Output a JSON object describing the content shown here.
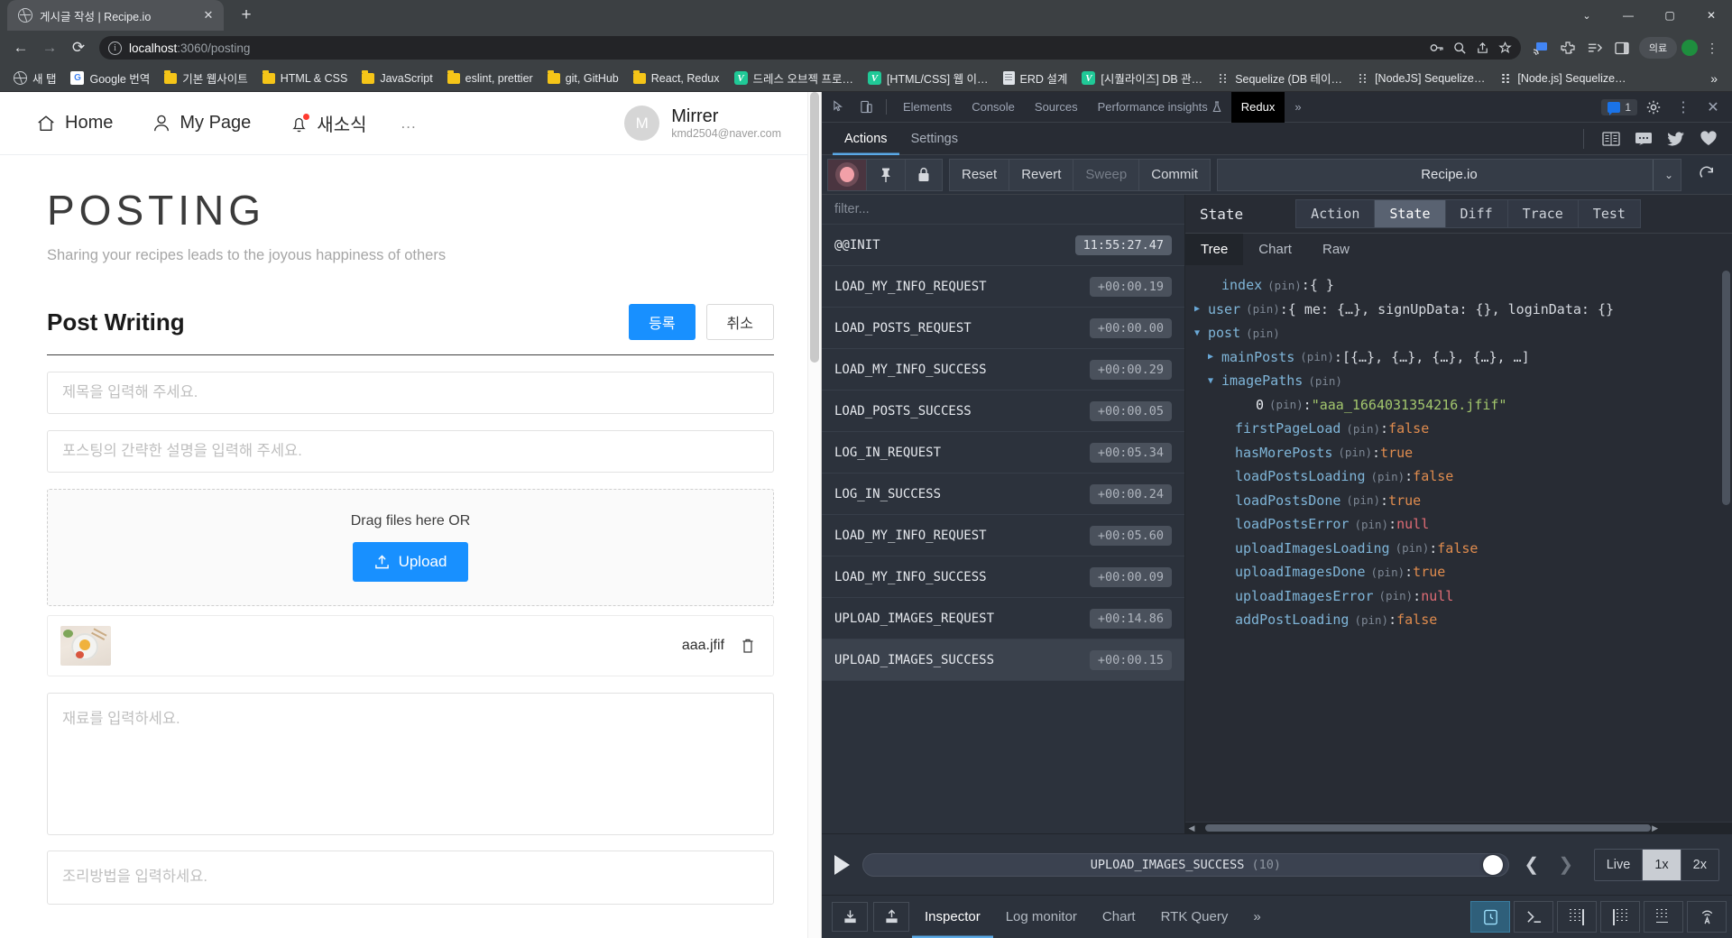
{
  "browser": {
    "tab": {
      "title": "게시글 작성 | Recipe.io",
      "close": "✕"
    },
    "newtab": "+",
    "window_controls": {
      "minimize": "—",
      "maximize": "▢",
      "close": "✕",
      "chevron": "⌄"
    },
    "nav": {
      "back": "←",
      "forward": "→",
      "reload": "⟳"
    },
    "url": {
      "host": "localhost",
      "path": ":3060/posting"
    },
    "omni_icons": [
      "key-icon",
      "zoom-icon",
      "share-icon",
      "bookmark-star-icon"
    ],
    "toolbar_icons": [
      "extension-cast-icon",
      "puzzle-extension-icon",
      "reading-list-icon",
      "sidepanel-icon"
    ],
    "profile_pill": "의료",
    "bookmarks": [
      {
        "label": "새 탭",
        "icon": "globe-icon"
      },
      {
        "label": "Google 번역",
        "icon": "google-translate-icon"
      },
      {
        "label": "기본 웹사이트",
        "icon": "folder-icon"
      },
      {
        "label": "HTML & CSS",
        "icon": "folder-icon"
      },
      {
        "label": "JavaScript",
        "icon": "folder-icon"
      },
      {
        "label": "eslint, prettier",
        "icon": "folder-icon"
      },
      {
        "label": "git, GitHub",
        "icon": "folder-icon"
      },
      {
        "label": "React, Redux",
        "icon": "folder-icon"
      },
      {
        "label": "드레스 오브젝 프로…",
        "icon": "velog-icon"
      },
      {
        "label": "[HTML/CSS] 웹 이…",
        "icon": "velog-icon"
      },
      {
        "label": "ERD 설계",
        "icon": "document-icon"
      },
      {
        "label": "[시퀄라이즈] DB 관…",
        "icon": "velog-icon"
      },
      {
        "label": "Sequelize (DB 테이…",
        "icon": "dots-icon"
      },
      {
        "label": "[NodeJS] Sequelize…",
        "icon": "dots-icon"
      },
      {
        "label": "[Node.js] Sequelize…",
        "icon": "dots-icon"
      }
    ],
    "bookmarks_overflow": "»"
  },
  "page": {
    "nav": [
      {
        "label": "Home",
        "icon": "home-icon"
      },
      {
        "label": "My Page",
        "icon": "user-icon"
      },
      {
        "label": "새소식",
        "icon": "bell-icon",
        "badge": true
      },
      {
        "label": "...",
        "icon": "more-icon"
      }
    ],
    "profile": {
      "initial": "M",
      "name": "Mirrer",
      "email": "kmd2504@naver.com"
    },
    "hero_title": "POSTING",
    "hero_subtitle": "Sharing your recipes leads to the joyous happiness of others",
    "section_title": "Post Writing",
    "submit_label": "등록",
    "cancel_label": "취소",
    "title_placeholder": "제목을 입력해 주세요.",
    "desc_placeholder": "포스팅의 간략한 설명을 입력해 주세요.",
    "dropzone_text": "Drag files here OR",
    "upload_label": "Upload",
    "file": {
      "name": "aaa.jfif",
      "delete_icon": "trash-icon",
      "thumb": "food-thumbnail"
    },
    "ingredients_placeholder": "재료를 입력하세요.",
    "recipe_placeholder": "조리방법을 입력하세요."
  },
  "devtools": {
    "top_tabs": [
      {
        "label": "Elements",
        "active": false
      },
      {
        "label": "Console",
        "active": false
      },
      {
        "label": "Sources",
        "active": false
      },
      {
        "label": "Performance insights",
        "active": false,
        "icon": "flask-icon"
      },
      {
        "label": "Redux",
        "active": true
      }
    ],
    "top_overflow": "»",
    "message_count": "1",
    "top_right_icons": [
      "settings-gear-icon",
      "more-vertical-icon",
      "close-icon"
    ],
    "inspect_icons": [
      "inspect-element-icon",
      "device-toolbar-icon"
    ],
    "redux_tabs": [
      {
        "label": "Actions",
        "active": true
      },
      {
        "label": "Settings",
        "active": false
      }
    ],
    "social_icons": [
      "docs-book-icon",
      "chat-icon",
      "twitter-icon",
      "heart-icon"
    ],
    "dispatch": {
      "record_icon": "record-icon",
      "pin_icon": "pin-icon",
      "lock_icon": "lock-icon",
      "buttons": [
        {
          "label": "Reset",
          "disabled": false
        },
        {
          "label": "Revert",
          "disabled": false
        },
        {
          "label": "Sweep",
          "disabled": true
        },
        {
          "label": "Commit",
          "disabled": false
        }
      ],
      "instance": "Recipe.io",
      "caret": "⌄",
      "refresh_icon": "refresh-icon"
    },
    "filter_placeholder": "filter...",
    "actions": [
      {
        "name": "@@INIT",
        "time": "11:55:27.47",
        "first": true
      },
      {
        "name": "LOAD_MY_INFO_REQUEST",
        "time": "+00:00.19"
      },
      {
        "name": "LOAD_POSTS_REQUEST",
        "time": "+00:00.00"
      },
      {
        "name": "LOAD_MY_INFO_SUCCESS",
        "time": "+00:00.29"
      },
      {
        "name": "LOAD_POSTS_SUCCESS",
        "time": "+00:00.05"
      },
      {
        "name": "LOG_IN_REQUEST",
        "time": "+00:05.34"
      },
      {
        "name": "LOG_IN_SUCCESS",
        "time": "+00:00.24"
      },
      {
        "name": "LOAD_MY_INFO_REQUEST",
        "time": "+00:05.60"
      },
      {
        "name": "LOAD_MY_INFO_SUCCESS",
        "time": "+00:00.09"
      },
      {
        "name": "UPLOAD_IMAGES_REQUEST",
        "time": "+00:14.86"
      },
      {
        "name": "UPLOAD_IMAGES_SUCCESS",
        "time": "+00:00.15",
        "selected": true
      }
    ],
    "inspector": {
      "title": "State",
      "tabs": [
        {
          "label": "Action",
          "active": false
        },
        {
          "label": "State",
          "active": true
        },
        {
          "label": "Diff",
          "active": false
        },
        {
          "label": "Trace",
          "active": false
        },
        {
          "label": "Test",
          "active": false
        }
      ],
      "view_tabs": [
        {
          "label": "Tree",
          "active": true
        },
        {
          "label": "Chart",
          "active": false
        },
        {
          "label": "Raw",
          "active": false
        }
      ],
      "tree": [
        {
          "indent": 1,
          "arrow": "",
          "key": "index",
          "pin": "(pin)",
          "sep": ": ",
          "value": "{ }",
          "vclass": "v-plain"
        },
        {
          "indent": 0,
          "arrow": "▶",
          "key": "user",
          "pin": "(pin)",
          "sep": ": ",
          "value": "{ me: {…}, signUpData: {}, loginData: {}",
          "vclass": "v-plain"
        },
        {
          "indent": 0,
          "arrow": "▼",
          "key": "post",
          "pin": "(pin)",
          "sep": "",
          "value": "",
          "vclass": "v-plain"
        },
        {
          "indent": 1,
          "arrow": "▶",
          "key": "mainPosts",
          "pin": "(pin)",
          "sep": ": ",
          "value": "[{…}, {…}, {…}, {…}, …]",
          "vclass": "v-plain"
        },
        {
          "indent": 1,
          "arrow": "▼",
          "key": "imagePaths",
          "pin": "(pin)",
          "sep": "",
          "value": "",
          "vclass": "v-plain"
        },
        {
          "indent": 3,
          "arrow": "",
          "key": "0",
          "pin": "(pin)",
          "sep": ": ",
          "value": "\"aaa_1664031354216.jfif\"",
          "vclass": "v-green",
          "kclass": "k-white"
        },
        {
          "indent": 2,
          "arrow": "",
          "key": "firstPageLoad",
          "pin": "(pin)",
          "sep": ": ",
          "value": "false",
          "vclass": "v-orange"
        },
        {
          "indent": 2,
          "arrow": "",
          "key": "hasMorePosts",
          "pin": "(pin)",
          "sep": ": ",
          "value": "true",
          "vclass": "v-orange"
        },
        {
          "indent": 2,
          "arrow": "",
          "key": "loadPostsLoading",
          "pin": "(pin)",
          "sep": ": ",
          "value": "false",
          "vclass": "v-orange"
        },
        {
          "indent": 2,
          "arrow": "",
          "key": "loadPostsDone",
          "pin": "(pin)",
          "sep": ": ",
          "value": "true",
          "vclass": "v-orange"
        },
        {
          "indent": 2,
          "arrow": "",
          "key": "loadPostsError",
          "pin": "(pin)",
          "sep": ": ",
          "value": "null",
          "vclass": "v-red"
        },
        {
          "indent": 2,
          "arrow": "",
          "key": "uploadImagesLoading",
          "pin": "(pin)",
          "sep": ": ",
          "value": "false",
          "vclass": "v-orange"
        },
        {
          "indent": 2,
          "arrow": "",
          "key": "uploadImagesDone",
          "pin": "(pin)",
          "sep": ": ",
          "value": "true",
          "vclass": "v-orange"
        },
        {
          "indent": 2,
          "arrow": "",
          "key": "uploadImagesError",
          "pin": "(pin)",
          "sep": ": ",
          "value": "null",
          "vclass": "v-red"
        },
        {
          "indent": 2,
          "arrow": "",
          "key": "addPostLoading",
          "pin": "(pin)",
          "sep": ": ",
          "value": "false",
          "vclass": "v-orange"
        }
      ]
    },
    "slider": {
      "current_action": "UPLOAD_IMAGES_SUCCESS",
      "count": "(10)",
      "play_icon": "play-icon",
      "prev": "❮",
      "next": "❯",
      "speeds": [
        {
          "label": "Live",
          "active": false
        },
        {
          "label": "1x",
          "active": true
        },
        {
          "label": "2x",
          "active": false
        }
      ]
    },
    "footer": {
      "left_icons": [
        "import-icon",
        "export-icon"
      ],
      "tabs": [
        {
          "label": "Inspector",
          "active": true
        },
        {
          "label": "Log monitor",
          "active": false
        },
        {
          "label": "Chart",
          "active": false
        },
        {
          "label": "RTK Query",
          "active": false
        }
      ],
      "overflow": "»",
      "right_icons": [
        "dock-bottom-icon",
        "terminal-icon",
        "grid-right-icon",
        "grid-left-icon",
        "grid-bottom-icon",
        "broadcast-icon"
      ]
    }
  }
}
